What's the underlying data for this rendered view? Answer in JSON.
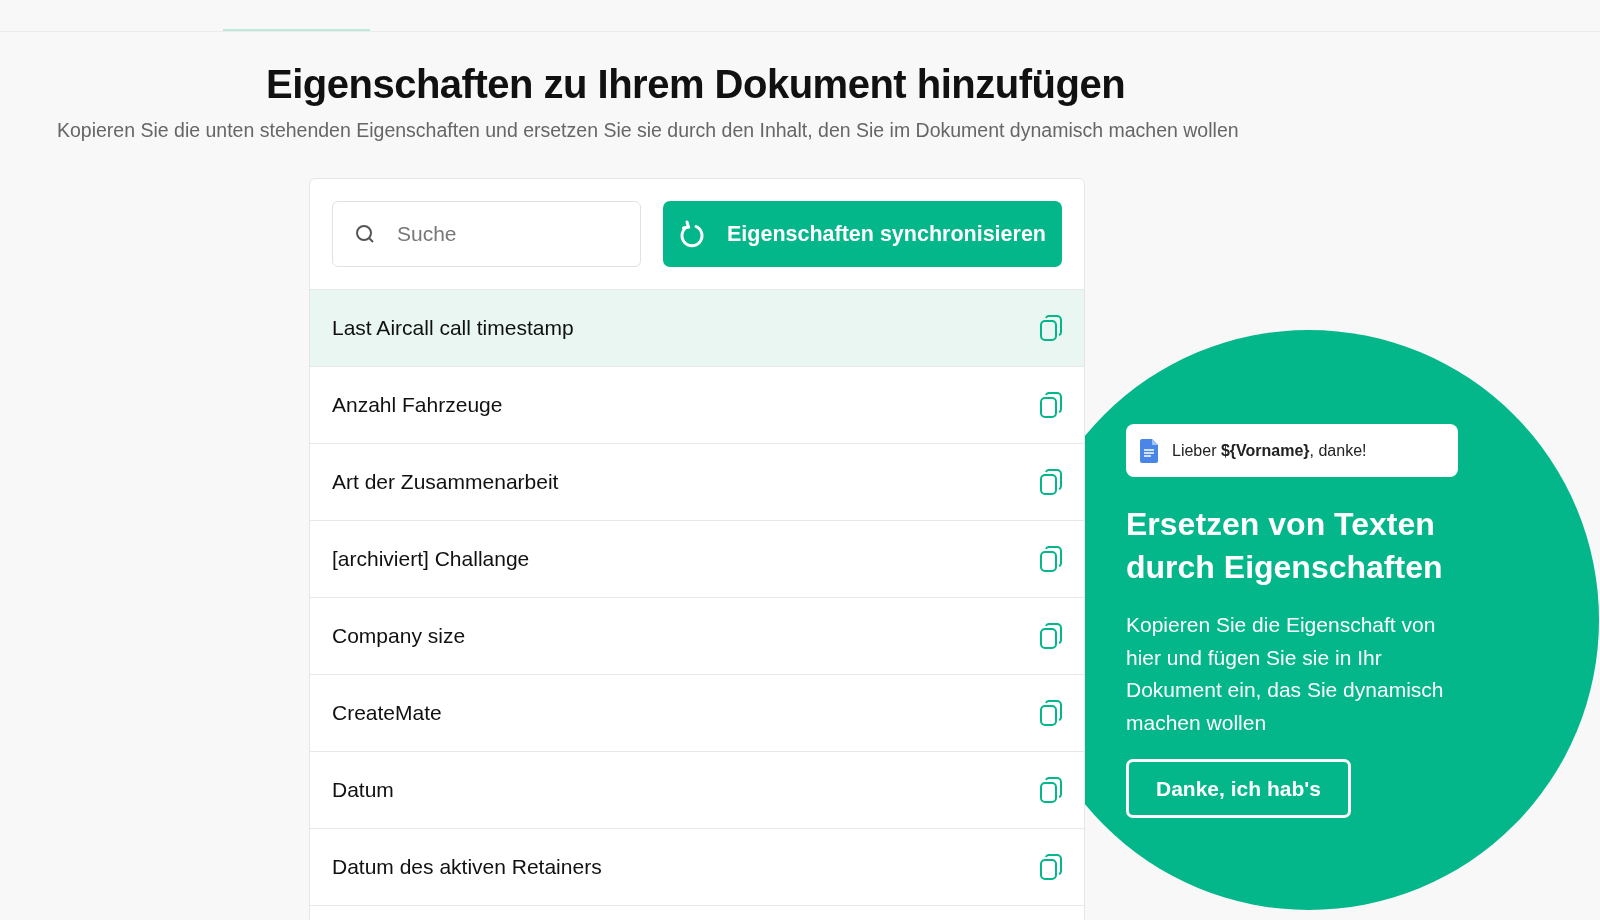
{
  "title": "Eigenschaften zu Ihrem Dokument hinzufügen",
  "subtitle": "Kopieren Sie die unten stehenden Eigenschaften und ersetzen Sie sie durch den Inhalt, den Sie im Dokument dynamisch machen wollen",
  "search": {
    "placeholder": "Suche"
  },
  "sync_button": "Eigenschaften synchronisieren",
  "properties": [
    {
      "name": "Last Aircall call timestamp",
      "selected": true
    },
    {
      "name": "Anzahl Fahrzeuge",
      "selected": false
    },
    {
      "name": "Art der Zusammenarbeit",
      "selected": false
    },
    {
      "name": "[archiviert] Challange",
      "selected": false
    },
    {
      "name": "Company size",
      "selected": false
    },
    {
      "name": "CreateMate",
      "selected": false
    },
    {
      "name": "Datum",
      "selected": false
    },
    {
      "name": "Datum des aktiven Retainers",
      "selected": false
    }
  ],
  "tip": {
    "example": "Lieber **${Vorname}**, danke!",
    "heading": "Ersetzen von Texten durch Eigenschaften",
    "text": "Kopieren Sie die Eigenschaft von hier und fügen Sie sie in Ihr Dokument ein, das Sie dynamisch machen wollen",
    "button": "Danke, ich hab's"
  }
}
